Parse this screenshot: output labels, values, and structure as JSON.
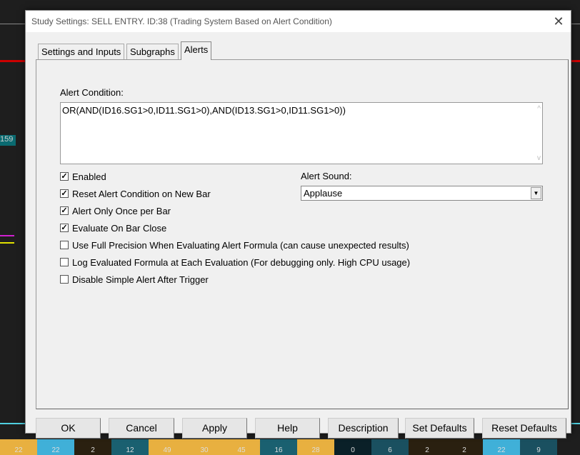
{
  "window": {
    "title": "Study Settings: SELL ENTRY. ID:38 (Trading System Based on Alert Condition)",
    "close": "✕"
  },
  "tabs": [
    {
      "label": "Settings and Inputs"
    },
    {
      "label": "Subgraphs"
    },
    {
      "label": "Alerts"
    }
  ],
  "alerts": {
    "condition_label": "Alert Condition:",
    "condition_value": "OR(AND(ID16.SG1>0,ID11.SG1>0),AND(ID13.SG1>0,ID11.SG1>0))",
    "checkboxes": [
      {
        "label": "Enabled",
        "checked": true
      },
      {
        "label": "Reset Alert Condition on New Bar",
        "checked": true
      },
      {
        "label": "Alert Only Once per Bar",
        "checked": true
      },
      {
        "label": "Evaluate On Bar Close",
        "checked": true
      },
      {
        "label": "Use Full Precision When Evaluating Alert Formula (can cause unexpected results)",
        "checked": false
      },
      {
        "label": "Log Evaluated Formula at Each Evaluation (For debugging only. High CPU usage)",
        "checked": false
      },
      {
        "label": "Disable Simple Alert After Trigger",
        "checked": false
      }
    ],
    "sound_label": "Alert Sound:",
    "sound_value": "Applause"
  },
  "buttons": [
    "OK",
    "Cancel",
    "Apply",
    "Help",
    "Description",
    "Set Defaults",
    "Reset Defaults"
  ],
  "background": {
    "price_label": "159",
    "strip_values": [
      "22",
      "22",
      "2",
      "12",
      "49",
      "30",
      "45",
      "16",
      "28",
      "0",
      "6",
      "2",
      "2",
      "22",
      "9"
    ],
    "strip_colors": [
      "#e8b040",
      "#40b0d8",
      "#2a2010",
      "#1a6070",
      "#e8b040",
      "#e8b040",
      "#e8b040",
      "#1a6070",
      "#e8b040",
      "#0a2028",
      "#1a5060",
      "#2a2010",
      "#2a2010",
      "#40b0d8",
      "#1a5060"
    ]
  }
}
